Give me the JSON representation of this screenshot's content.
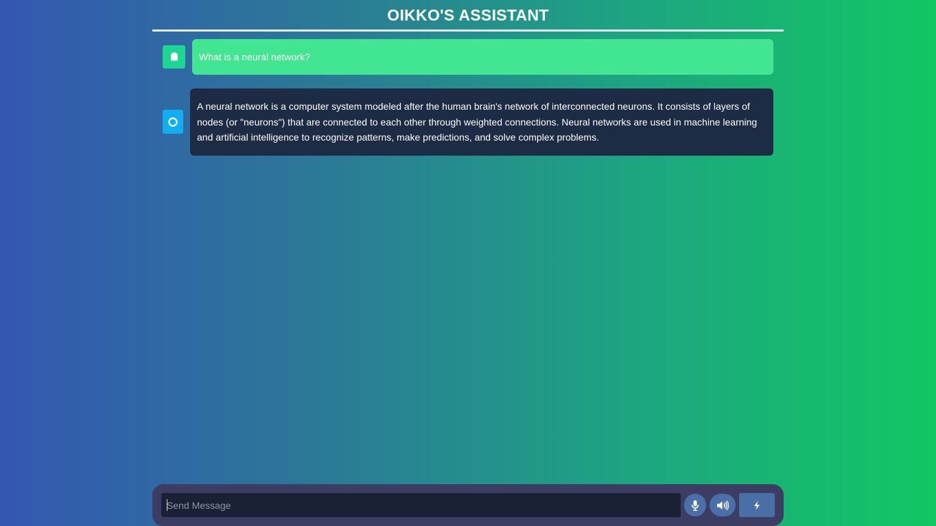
{
  "header": {
    "title": "OIKKO'S ASSISTANT"
  },
  "conversation": [
    {
      "role": "user",
      "avatar_icon": "ghost-icon",
      "text": "What is a neural network?"
    },
    {
      "role": "assistant",
      "avatar_icon": "ring-icon",
      "text": "A neural network is a computer system modeled after the human brain's network of interconnected neurons. It consists of layers of nodes (or \"neurons\") that are connected to each other through weighted connections. Neural networks are used in machine learning and artificial intelligence to recognize patterns, make predictions, and solve complex problems."
    }
  ],
  "composer": {
    "placeholder": "Send Message",
    "value": "",
    "mic_icon": "microphone-icon",
    "speaker_icon": "speaker-icon",
    "send_icon": "bolt-icon"
  },
  "colors": {
    "user_bubble": "#42e592",
    "assistant_bubble": "#1e2b44",
    "user_avatar": "#1ed694",
    "assistant_avatar": "#11aef2",
    "composer_bg": "#3b3d62",
    "button_bg": "#4b6fa8"
  }
}
